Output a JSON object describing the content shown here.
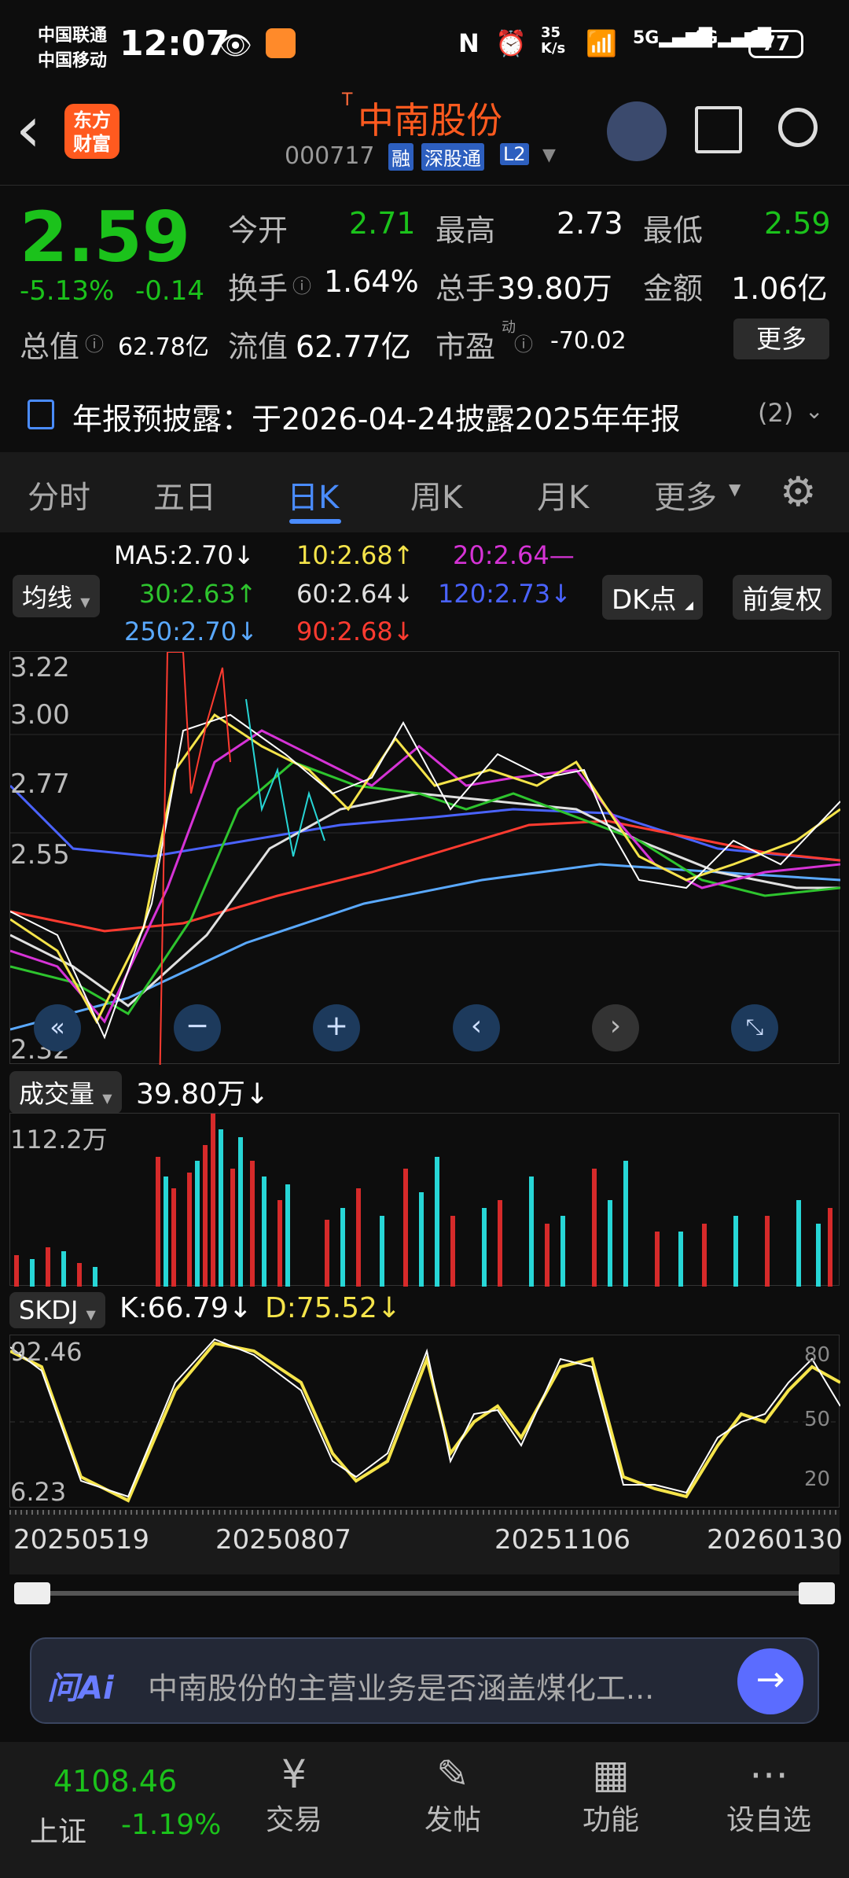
{
  "status": {
    "carrier1": "中国联通",
    "carrier2": "中国移动",
    "time": "12:07",
    "speed": "35\nK/s",
    "battery": "77"
  },
  "header": {
    "back": "‹",
    "logo_line1": "东方",
    "logo_line2": "财富",
    "title_prefix": "T",
    "title": "中南股份",
    "code": "000717",
    "tag1": "融",
    "tag2": "深股通",
    "tag3": "L2"
  },
  "quote": {
    "price": "2.59",
    "pct": "-5.13%",
    "chg": "-0.14",
    "open_label": "今开",
    "open": "2.71",
    "high_label": "最高",
    "high": "2.73",
    "low_label": "最低",
    "low": "2.59",
    "turnover_label": "换手",
    "turnover": "1.64%",
    "vol_label": "总手",
    "vol": "39.80万",
    "amount_label": "金额",
    "amount": "1.06亿",
    "mcap_label": "总值",
    "mcap": "62.78亿",
    "float_label": "流值",
    "float": "62.77亿",
    "pe_label": "市盈",
    "pe_sup": "动",
    "pe": "-70.02",
    "more": "更多"
  },
  "notice": {
    "text": "年报预披露：于2026-04-24披露2025年年报",
    "count": "(2)"
  },
  "tabs": [
    "分时",
    "五日",
    "日K",
    "周K",
    "月K",
    "更多"
  ],
  "ma": {
    "label": "均线",
    "ma5": "MA5:2.70",
    "ma10": "10:2.68",
    "ma20": "20:2.64",
    "ma30": "30:2.63",
    "ma60": "60:2.64",
    "ma120": "120:2.73",
    "ma250": "250:2.70",
    "ma90": "90:2.68",
    "dk": "DK点",
    "fq": "前复权",
    "colors": {
      "ma5": "#ffffff",
      "ma10": "#f5e44a",
      "ma20": "#d633d6",
      "ma30": "#2ec42e",
      "ma60": "#e0e0e0",
      "ma120": "#4a63ff",
      "ma250": "#5aa9ff",
      "ma90": "#ff3b30"
    }
  },
  "kchart": {
    "y_labels": [
      "3.22",
      "3.00",
      "2.77",
      "2.55",
      "2.32"
    ]
  },
  "volume": {
    "label": "成交量",
    "value": "39.80万",
    "max": "112.2万"
  },
  "skdj": {
    "label": "SKDJ",
    "k": "K:66.79",
    "d": "D:75.52",
    "top": "92.46",
    "bottom": "6.23",
    "lv80": "80",
    "lv50": "50",
    "lv20": "20"
  },
  "dates": [
    "20250519",
    "20250807",
    "20251106",
    "20260130"
  ],
  "ai": {
    "logo": "问Ai",
    "text": "中南股份的主营业务是否涵盖煤化工..."
  },
  "nav": {
    "index_val": "4108.46",
    "index_name": "上证",
    "index_pct": "-1.19%",
    "trade": "交易",
    "post": "发帖",
    "func": "功能",
    "fav": "设自选"
  }
}
